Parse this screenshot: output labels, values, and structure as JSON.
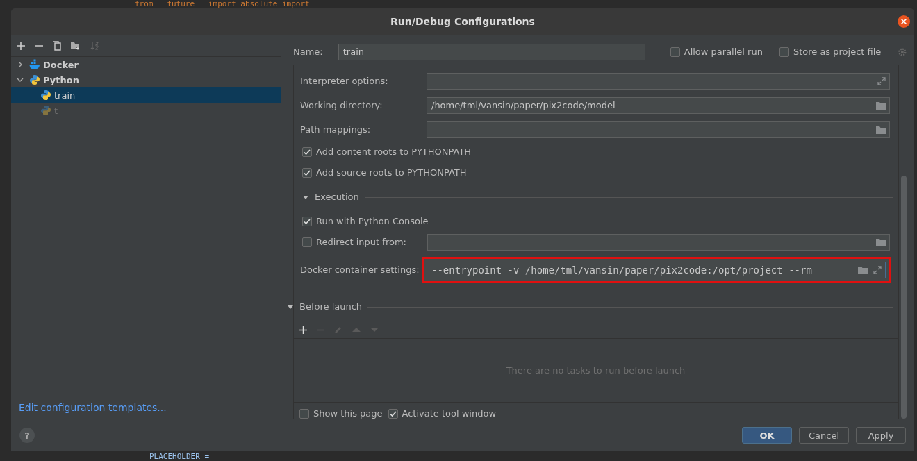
{
  "editor": {
    "code_line": "from __future__ import absolute_import",
    "bottom_line": "PLACEHOLDER ="
  },
  "window": {
    "title": "Run/Debug Configurations"
  },
  "tree": [
    {
      "label": "Docker",
      "kind": "docker",
      "expanded": false,
      "selected": false
    },
    {
      "label": "Python",
      "kind": "python",
      "expanded": true,
      "selected": false,
      "children": [
        {
          "label": "train",
          "selected": true,
          "disabled": false
        },
        {
          "label": "t",
          "selected": false,
          "disabled": true
        }
      ]
    }
  ],
  "templates_link": "Edit configuration templates...",
  "name": {
    "label": "Name:",
    "value": "train"
  },
  "options": [
    {
      "label": "Allow parallel run",
      "checked": false
    },
    {
      "label": "Store as project file",
      "checked": false
    }
  ],
  "rows": [
    {
      "kind": "field",
      "label": "Interpreter options:",
      "value": "",
      "browse": false,
      "expandable": true
    },
    {
      "kind": "field",
      "label": "Working directory:",
      "value": "/home/tml/vansin/paper/pix2code/model",
      "browse": true,
      "expandable": false
    },
    {
      "kind": "field",
      "label": "Path mappings:",
      "value": "",
      "browse": true,
      "expandable": false
    },
    {
      "kind": "checkbox",
      "label": "Add content roots to PYTHONPATH",
      "checked": true
    },
    {
      "kind": "checkbox",
      "label": "Add source roots to PYTHONPATH",
      "checked": true
    },
    {
      "kind": "section",
      "title": "Execution",
      "expanded": true,
      "rows": [
        {
          "kind": "checkbox",
          "label": "Run with Python Console",
          "checked": true
        },
        {
          "kind": "checkbox",
          "label": "Redirect input from:",
          "checked": false,
          "field": true
        },
        {
          "kind": "field",
          "label": "Docker container settings:",
          "value": "--entrypoint -v /home/tml/vansin/paper/pix2code:/opt/project --rm",
          "browse": true,
          "expandable": true,
          "mono": true,
          "highlighted": true
        }
      ]
    }
  ],
  "before_launch": {
    "title": "Before launch",
    "expanded": true,
    "empty_text": "There are no tasks to run before launch"
  },
  "launch_options": [
    {
      "label": "Show this page",
      "checked": false
    },
    {
      "label": "Activate tool window",
      "checked": true
    }
  ],
  "help": "?",
  "buttons": [
    {
      "label": "OK",
      "default": true
    },
    {
      "label": "Cancel",
      "default": false
    },
    {
      "label": "Apply",
      "default": false
    }
  ]
}
